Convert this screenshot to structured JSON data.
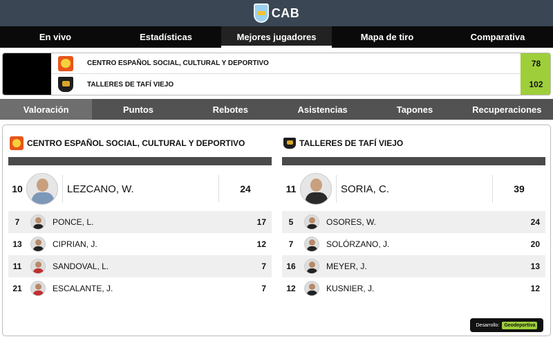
{
  "header": {
    "logo_text": "CAB"
  },
  "main_nav": [
    {
      "label": "En vivo"
    },
    {
      "label": "Estadísticas"
    },
    {
      "label": "Mejores jugadores"
    },
    {
      "label": "Mapa de tiro"
    },
    {
      "label": "Comparativa"
    }
  ],
  "scoreboard": {
    "home": {
      "name": "CENTRO ESPAÑOL SOCIAL, CULTURAL Y DEPORTIVO",
      "score": "78"
    },
    "away": {
      "name": "TALLERES DE TAFÍ VIEJO",
      "score": "102"
    }
  },
  "stat_tabs": [
    {
      "label": "Valoración"
    },
    {
      "label": "Puntos"
    },
    {
      "label": "Rebotes"
    },
    {
      "label": "Asistencias"
    },
    {
      "label": "Tapones"
    },
    {
      "label": "Recuperaciones"
    }
  ],
  "leaders": {
    "home": {
      "team": "CENTRO ESPAÑOL SOCIAL, CULTURAL Y DEPORTIVO",
      "top": {
        "number": "10",
        "name": "LEZCANO, W.",
        "value": "24"
      },
      "others": [
        {
          "number": "7",
          "name": "PONCE, L.",
          "value": "17"
        },
        {
          "number": "13",
          "name": "CIPRIAN, J.",
          "value": "12"
        },
        {
          "number": "11",
          "name": "SANDOVAL, L.",
          "value": "7"
        },
        {
          "number": "21",
          "name": "ESCALANTE, J.",
          "value": "7"
        }
      ]
    },
    "away": {
      "team": "TALLERES DE TAFÍ VIEJO",
      "top": {
        "number": "11",
        "name": "SORIA, C.",
        "value": "39"
      },
      "others": [
        {
          "number": "5",
          "name": "OSORES, W.",
          "value": "24"
        },
        {
          "number": "7",
          "name": "SOLÓRZANO, J.",
          "value": "20"
        },
        {
          "number": "16",
          "name": "MEYER, J.",
          "value": "13"
        },
        {
          "number": "12",
          "name": "KUSNIER, J.",
          "value": "12"
        }
      ]
    }
  },
  "credit": {
    "label": "Desarrollo:",
    "brand": "Geodeportiva"
  }
}
